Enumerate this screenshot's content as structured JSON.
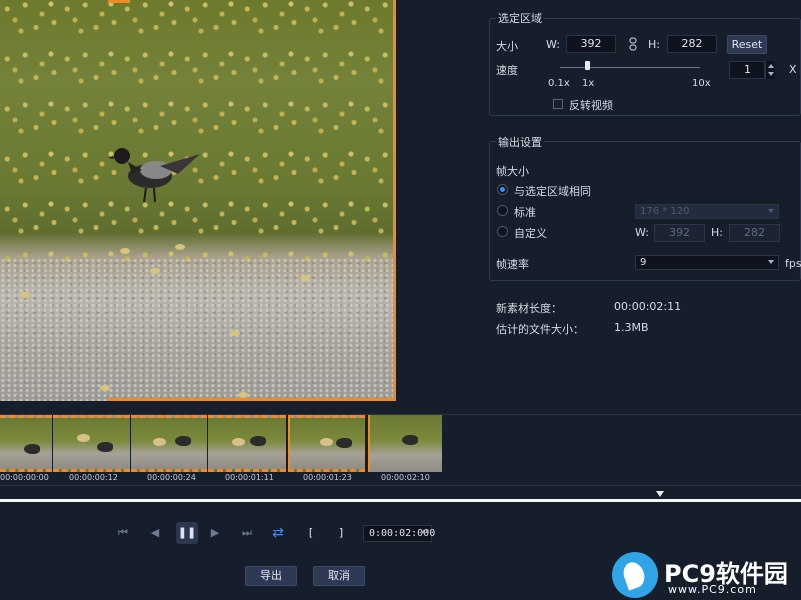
{
  "selection": {
    "title": "选定区域",
    "size_label": "大小",
    "w_label": "W:",
    "w_value": "392",
    "h_label": "H:",
    "h_value": "282",
    "reset_label": "Reset",
    "speed_label": "速度",
    "speed_ticks": [
      "0.1x",
      "1x",
      "10x"
    ],
    "speed_value": "1",
    "speed_unit": "X",
    "reverse_label": "反转视频"
  },
  "output": {
    "title": "输出设置",
    "frame_size_label": "帧大小",
    "opt_same": "与选定区域相同",
    "opt_standard": "标准",
    "standard_value": "176 * 120",
    "opt_custom": "自定义",
    "w_label": "W:",
    "w_value": "392",
    "h_label": "H:",
    "h_value": "282",
    "fps_label": "帧速率",
    "fps_value": "9",
    "fps_unit": "fps"
  },
  "info": {
    "length_label": "新素材长度：",
    "length_value": "00:00:02:11",
    "size_label": "估计的文件大小：",
    "size_value": "1.3MB"
  },
  "timeline": {
    "timecodes": [
      "00:00:00:00",
      "00:00:00:12",
      "00:00:00:24",
      "00:00:01:11",
      "00:00:01:23",
      "00:00:02:10"
    ]
  },
  "transport": {
    "first": "⏮",
    "prev": "◀",
    "pause": "❚❚",
    "next": "▶",
    "last": "⏭",
    "loop": "⇄",
    "mark_in": "[",
    "mark_out": "]",
    "timecode": "0:00:02:000",
    "timecode_spin": "▲▼"
  },
  "actions": {
    "export_label": "导出",
    "cancel_label": "取消"
  },
  "watermark": {
    "brand": "PC9软件园",
    "url": "www.PC9.com"
  },
  "colors": {
    "background": "#161d2b",
    "accent": "#3d8cff",
    "crop": "#f08a24"
  }
}
